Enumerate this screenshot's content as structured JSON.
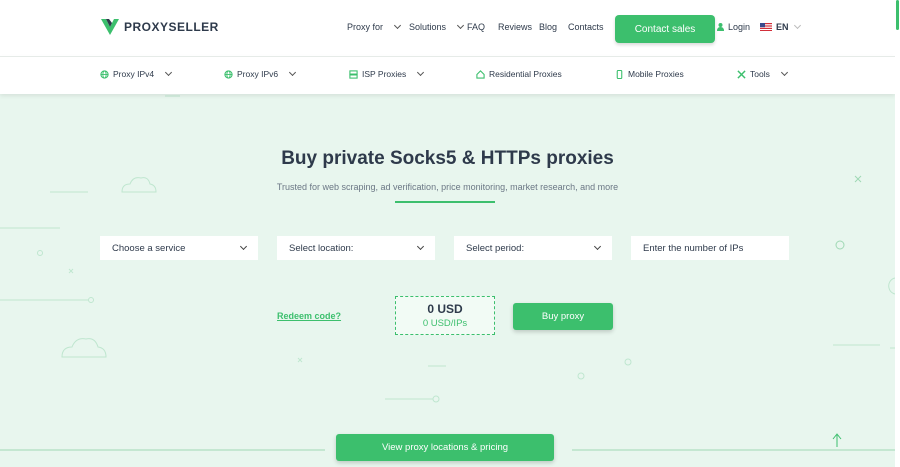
{
  "colors": {
    "brand": "#3cbf6d",
    "text": "#2e3a4b",
    "bg": "#e8f6ee"
  },
  "header": {
    "logo_text": "PROXYSELLER",
    "nav": {
      "proxy_for": "Proxy for",
      "solutions": "Solutions",
      "faq": "FAQ",
      "reviews": "Reviews",
      "blog": "Blog",
      "contacts": "Contacts"
    },
    "contact_sales": "Contact sales",
    "login": "Login",
    "language": "EN"
  },
  "subnav": {
    "ipv4": "Proxy IPv4",
    "ipv6": "Proxy IPv6",
    "isp": "ISP Proxies",
    "residential": "Residential Proxies",
    "mobile": "Mobile Proxies",
    "tools": "Tools"
  },
  "hero": {
    "title": "Buy private Socks5 & HTTPs proxies",
    "subtitle": "Trusted for web scraping, ad verification, price monitoring, market research, and more"
  },
  "form": {
    "service": "Choose a service",
    "location": "Select location:",
    "period": "Select period:",
    "ips_placeholder": "Enter the number of IPs"
  },
  "order": {
    "redeem": "Redeem code?",
    "total": "0 USD",
    "per_ip": "0 USD/IPs",
    "buy": "Buy proxy"
  },
  "footer_cta": {
    "view_locations": "View proxy locations & pricing"
  }
}
